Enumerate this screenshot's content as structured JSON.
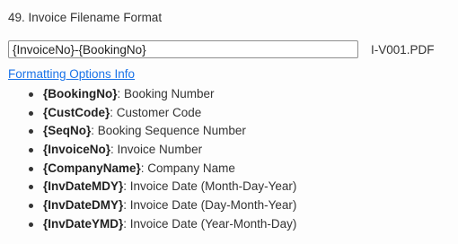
{
  "setting": {
    "title": "49. Invoice Filename Format",
    "input_value": "{InvoiceNo}-{BookingNo}",
    "preview": "I-V001.PDF",
    "help_link": "Formatting Options Info"
  },
  "options": [
    {
      "token": "{BookingNo}",
      "desc": ": Booking Number"
    },
    {
      "token": "{CustCode}",
      "desc": ": Customer Code"
    },
    {
      "token": "{SeqNo}",
      "desc": ": Booking Sequence Number"
    },
    {
      "token": "{InvoiceNo}",
      "desc": ": Invoice Number"
    },
    {
      "token": "{CompanyName}",
      "desc": ": Company Name"
    },
    {
      "token": "{InvDateMDY}",
      "desc": ": Invoice Date (Month-Day-Year)"
    },
    {
      "token": "{InvDateDMY}",
      "desc": ": Invoice Date (Day-Month-Year)"
    },
    {
      "token": "{InvDateYMD}",
      "desc": ": Invoice Date (Year-Month-Day)"
    }
  ],
  "colors": {
    "link": "#1a73e8",
    "text": "#333333",
    "border": "#8f8f8f"
  }
}
